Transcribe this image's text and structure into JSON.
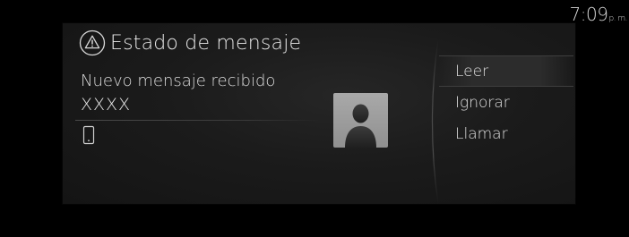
{
  "status_bar": {
    "time": "7:09",
    "ampm": "p. m."
  },
  "dialog": {
    "title": "Estado de mensaje",
    "title_icon": "warning-triangle-icon",
    "message_label": "Nuevo mensaje recibido",
    "sender": "XXXX",
    "device_icon": "mobile-phone-icon",
    "avatar_icon": "contact-silhouette-icon"
  },
  "menu": {
    "items": [
      {
        "label": "Leer",
        "selected": true
      },
      {
        "label": "Ignorar",
        "selected": false
      },
      {
        "label": "Llamar",
        "selected": false
      }
    ]
  }
}
